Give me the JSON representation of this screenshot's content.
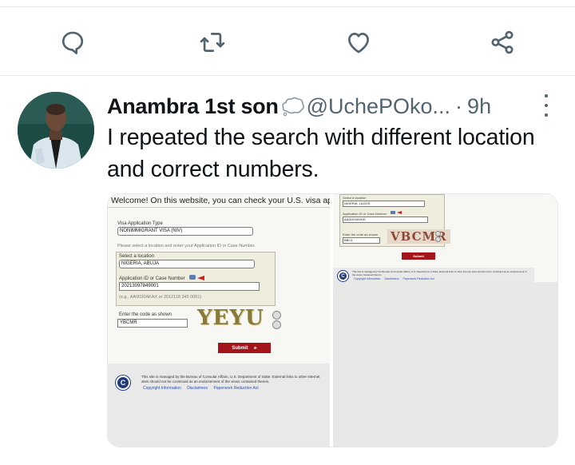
{
  "tweet": {
    "author_name": "Anambra 1st son",
    "author_handle": "@UchePOko...",
    "separator": "·",
    "time": "9h",
    "text": "I repeated the search with different location and correct numbers."
  },
  "actions": {
    "reply_icon": "reply-icon",
    "retweet_icon": "retweet-icon",
    "like_icon": "like-icon",
    "share_icon": "share-icon"
  },
  "screenshot1": {
    "welcome": "Welcome! On this website, you can check your U.S. visa applic",
    "visa_type_label": "Visa Application Type",
    "visa_type_value": "NONIMMIGRANT VISA (NIV)",
    "instruction": "Please select a location and enter your Application ID or Case Number.",
    "location_label": "Select a location",
    "location_value": "NIGERIA, ABUJA",
    "app_id_label": "Application ID or Case Number",
    "app_id_value": "20213097849001",
    "app_id_hint": "(e.g., AA0020AKAX or 2012118 345 0001)",
    "captcha_label": "Enter the code as shown",
    "captcha_input": "YBCMR",
    "captcha_image": "YEYU",
    "submit": "Submit",
    "footer_text": "This site is managed by the Bureau of Consular Affairs, U.S. Department of State. External links to other Internet sites should not be construed as an endorsement of the views contained therein.",
    "footer_links": [
      "Copyright Information",
      "Disclaimers",
      "Paperwork Reduction Act"
    ],
    "seal_letter": "C"
  },
  "screenshot2": {
    "location_label": "Select a location",
    "location_value": "NIGERIA, LAGOS",
    "app_id_label": "Application ID or Case Number",
    "app_id_value": "AA00G1MXHS",
    "captcha_label": "Enter the code as shown",
    "captcha_input": "BBC4",
    "captcha_image": "VBCMR",
    "submit": "Submit",
    "footer_text": "This site is managed by the Bureau of Consular Affairs, U.S. Department of State. External links to other Internet sites should not be construed as an endorsement of the views contained therein.",
    "footer_links": [
      "Copyright Information",
      "Disclaimers",
      "Paperwork Reduction Act"
    ],
    "seal_letter": "C"
  },
  "colors": {
    "text_primary": "#0f1419",
    "text_secondary": "#536471",
    "submit_red": "#a4151b",
    "seal_blue": "#1f3b7a"
  }
}
